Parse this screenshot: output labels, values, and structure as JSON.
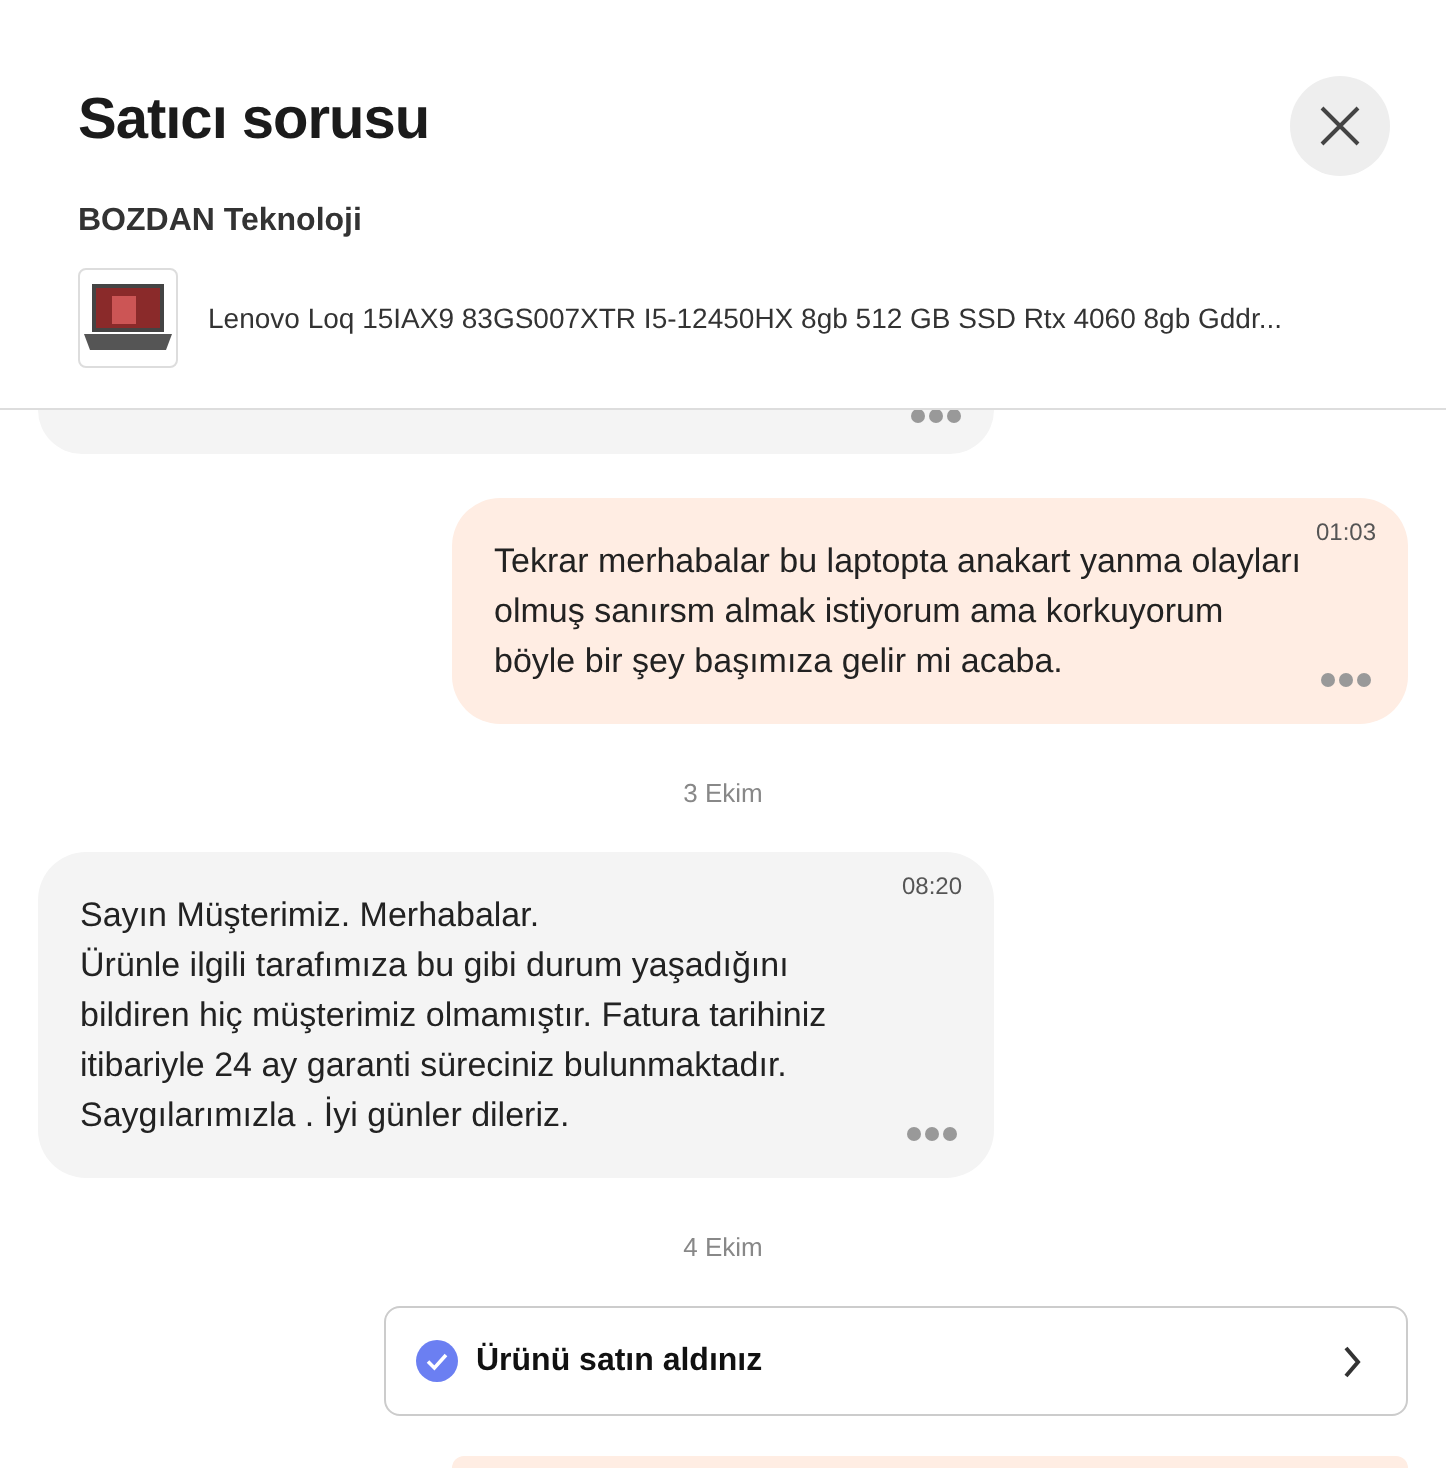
{
  "header": {
    "title": "Satıcı sorusu",
    "seller": "BOZDAN Teknoloji",
    "product": {
      "name": "Lenovo Loq 15IAX9 83GS007XTR I5-12450HX 8gb 512 GB SSD Rtx 4060 8gb Gddr..."
    }
  },
  "thread": [
    {
      "kind": "incoming_fragment"
    },
    {
      "kind": "outgoing",
      "time": "01:03",
      "text": "Tekrar merhabalar bu laptopta anakart yanma olayları olmuş sanırsm almak istiyorum ama korkuyorum böyle bir şey başımıza gelir mi acaba."
    },
    {
      "kind": "date",
      "text": "3 Ekim"
    },
    {
      "kind": "incoming",
      "time": "08:20",
      "text": "Sayın Müşterimiz. Merhabalar.\nÜrünle ilgili tarafımıza bu gibi durum yaşadığını bildiren hiç müşterimiz olmamıştır. Fatura tarihiniz itibariyle 24 ay garanti süreciniz bulunmaktadır. Saygılarımızla . İyi günler dileriz."
    },
    {
      "kind": "date",
      "text": "4 Ekim"
    },
    {
      "kind": "purchase",
      "text": "Ürünü satın aldınız"
    },
    {
      "kind": "outgoing_fragment"
    }
  ]
}
